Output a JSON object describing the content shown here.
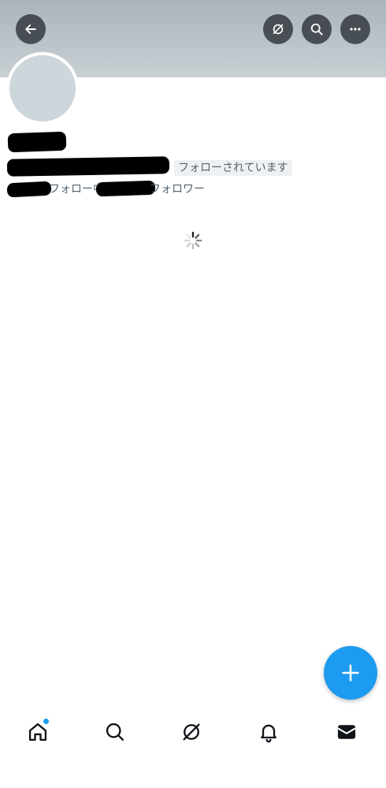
{
  "profile": {
    "follows_you_badge": "フォローされています",
    "following_label": "フォロー中",
    "followers_label": "フォロワー"
  },
  "header": {
    "buttons": [
      "back-arrow-icon",
      "grok-icon",
      "search-icon",
      "more-icon"
    ]
  },
  "nav": {
    "items": [
      "home-icon",
      "search-icon",
      "grok-icon",
      "notifications-icon",
      "messages-icon"
    ],
    "home_has_notification_dot": true
  },
  "colors": {
    "accent": "#1d9bf0",
    "banner": "#b4bec4",
    "secondary_text": "#536471"
  }
}
